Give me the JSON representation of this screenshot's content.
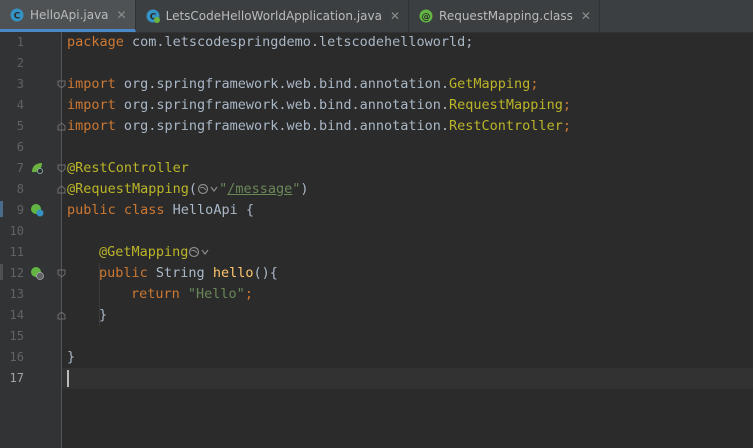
{
  "tabs": [
    {
      "label": "HelloApi.java",
      "icon": "class-icon",
      "active": true
    },
    {
      "label": "LetsCodeHelloWorldApplication.java",
      "icon": "spring-class-icon",
      "active": false
    },
    {
      "label": "RequestMapping.class",
      "icon": "annotation-class-icon",
      "active": false
    }
  ],
  "editor": {
    "line_numbers": [
      "1",
      "2",
      "3",
      "4",
      "5",
      "6",
      "7",
      "8",
      "9",
      "10",
      "11",
      "12",
      "13",
      "14",
      "15",
      "16",
      "17"
    ],
    "lines": {
      "l1": {
        "kw": "package",
        "rest": " com.letscodespringdemo.letscodehelloworld;"
      },
      "l3": {
        "kw": "import",
        "pkg": " org.springframework.web.bind.annotation.",
        "cls": "GetMapping",
        ";": ";"
      },
      "l4": {
        "kw": "import",
        "pkg": " org.springframework.web.bind.annotation.",
        "cls": "RequestMapping",
        ";": ";"
      },
      "l5": {
        "kw": "import",
        "pkg": " org.springframework.web.bind.annotation.",
        "cls": "RestController",
        ";": ";"
      },
      "l7": {
        "ann": "@RestController"
      },
      "l8": {
        "ann": "@RequestMapping",
        "open": "(",
        "str_open": "\"",
        "url": "/message",
        "str_close": "\"",
        "close": ")"
      },
      "l9": {
        "kw": "public class",
        "rest": " HelloApi {"
      },
      "l11": {
        "ann": "@GetMapping"
      },
      "l12": {
        "kw": "public",
        "type": " String ",
        "fn": "hello",
        "rest": "(){"
      },
      "l13": {
        "kw": "return",
        "str": " \"Hello\"",
        "semi": ";"
      },
      "l14": {
        "rest": "}"
      },
      "l16": {
        "rest": "}"
      }
    }
  },
  "colors": {
    "background": "#2b2b2b",
    "keyword": "#cc7832",
    "annotation": "#bbb529",
    "string": "#6a8759",
    "method": "#ffc66d",
    "text": "#a9b7c6"
  }
}
